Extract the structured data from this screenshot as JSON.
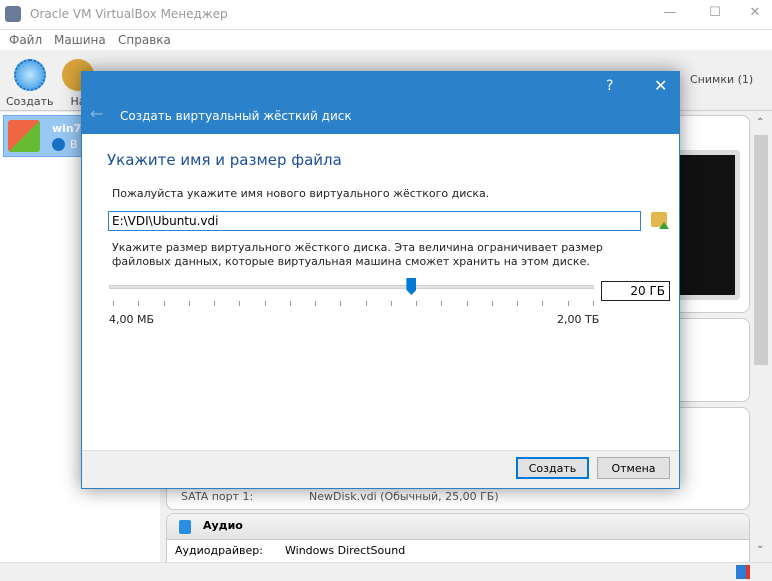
{
  "window": {
    "title": "Oracle VM VirtualBox Менеджер"
  },
  "menu": [
    "Файл",
    "Машина",
    "Справка"
  ],
  "toolbar": {
    "create": "Создать",
    "settings_partial": "На",
    "snapshots": "Снимки (1)"
  },
  "vm_list": [
    {
      "name": "win7",
      "state_partial": "В"
    }
  ],
  "details": {
    "storage_row": {
      "label": "SATA порт 1:",
      "value": "NewDisk.vdi (Обычный, 25,00 ГБ)"
    },
    "audio": {
      "header": "Аудио",
      "rows": [
        {
          "label": "Аудиодрайвер:",
          "value": "Windows DirectSound"
        }
      ]
    }
  },
  "dialog": {
    "title": "Создать виртуальный жёсткий диск",
    "help": "?",
    "heading": "Укажите имя и размер файла",
    "name_prompt": "Пожалуйста укажите имя нового виртуального жёсткого диска.",
    "path_value": "E:\\VDI\\Ubuntu.vdi",
    "size_prompt": "Укажите размер виртуального жёсткого диска. Эта величина ограничивает размер файловых данных, которые виртуальная машина сможет хранить на этом диске.",
    "slider": {
      "min_label": "4,00 МБ",
      "max_label": "2,00 ТБ",
      "position_fraction": 0.63
    },
    "size_value": "20 ГБ",
    "create_button": "Создать",
    "cancel_button": "Отмена"
  },
  "colors": {
    "accent": "#2b82cb",
    "heading": "#1a4f9c"
  }
}
